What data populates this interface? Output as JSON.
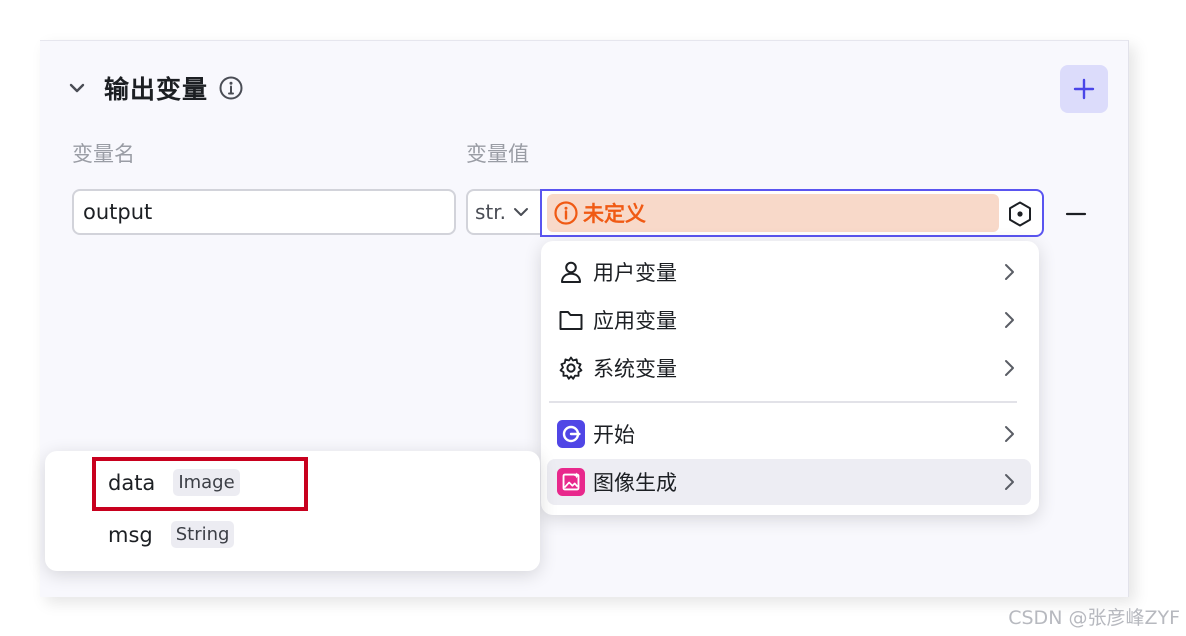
{
  "section": {
    "title": "输出变量"
  },
  "columns": {
    "name_label": "变量名",
    "value_label": "变量值"
  },
  "row": {
    "name_value": "output",
    "type_value": "str.",
    "value_status": "未定义"
  },
  "dropdown": {
    "items": [
      {
        "label": "用户变量",
        "icon": "user-icon"
      },
      {
        "label": "应用变量",
        "icon": "folder-icon"
      },
      {
        "label": "系统变量",
        "icon": "gear-icon"
      },
      {
        "label": "开始",
        "icon": "start-node-icon"
      },
      {
        "label": "图像生成",
        "icon": "image-gen-node-icon"
      }
    ],
    "active_item": "图像生成"
  },
  "submenu": {
    "items": [
      {
        "name": "data",
        "type": "Image"
      },
      {
        "name": "msg",
        "type": "String"
      }
    ]
  },
  "watermark": "CSDN @张彦峰ZYF",
  "colors": {
    "accent": "#5a55f0",
    "warning": "#f05a14",
    "warning_bg": "#f8d9c9",
    "highlight_border": "#c8001e",
    "start_node": "#5046e6",
    "image_node": "#e8288c"
  }
}
